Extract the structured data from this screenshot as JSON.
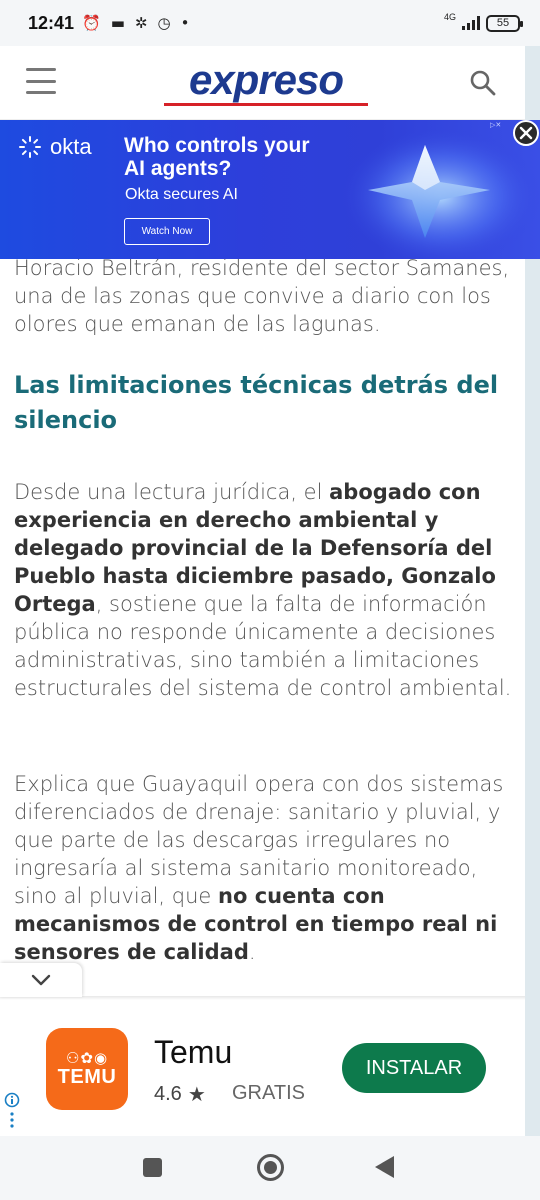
{
  "status_bar": {
    "time": "12:41",
    "network": "4G",
    "battery": "55"
  },
  "header": {
    "logo": "expreso",
    "menu_icon": "hamburger-icon",
    "search_icon": "search-icon"
  },
  "article": {
    "partial_line_1": "Horacio Beltrán, residente del sector Samanes,",
    "partial_line_2": "una de las zonas que convive a diario con los",
    "partial_line_3": "olores que emanan de las lagunas.",
    "heading": "Las limitaciones técnicas detrás del silencio",
    "para2": {
      "pre": "Desde una lectura jurídica, el ",
      "bold": "abogado con experiencia en derecho ambiental y delegado provincial de la Defensoría del Pueblo hasta diciembre pasado, Gonzalo Ortega",
      "post": ", sostiene que la falta de información pública no responde únicamente a decisiones administrativas, sino también a limitaciones estructurales del sistema de control ambiental."
    },
    "para3": {
      "pre": "Explica que Guayaquil opera con dos sistemas diferenciados de drenaje: sanitario y pluvial, y que parte de las descargas irregulares no ingresaría al sistema sanitario monitoreado, sino al pluvial, que ",
      "bold": "no cuenta con mecanismos de control en tiempo real ni sensores de calidad",
      "post": "."
    }
  },
  "top_ad": {
    "brand": "okta",
    "headline": "Who controls your AI agents?",
    "subline": "Okta secures AI",
    "cta": "Watch Now"
  },
  "bottom_ad": {
    "app_name": "Temu",
    "icon_text": "TEMU",
    "rating": "4.6",
    "price": "GRATIS",
    "install": "INSTALAR"
  },
  "colors": {
    "heading": "#1a6b78",
    "logo_blue": "#1d3a8f",
    "logo_red": "#d62128",
    "okta_blue": "#2d3fdb",
    "temu_orange": "#f56a19",
    "install_green": "#0d7a4c"
  }
}
